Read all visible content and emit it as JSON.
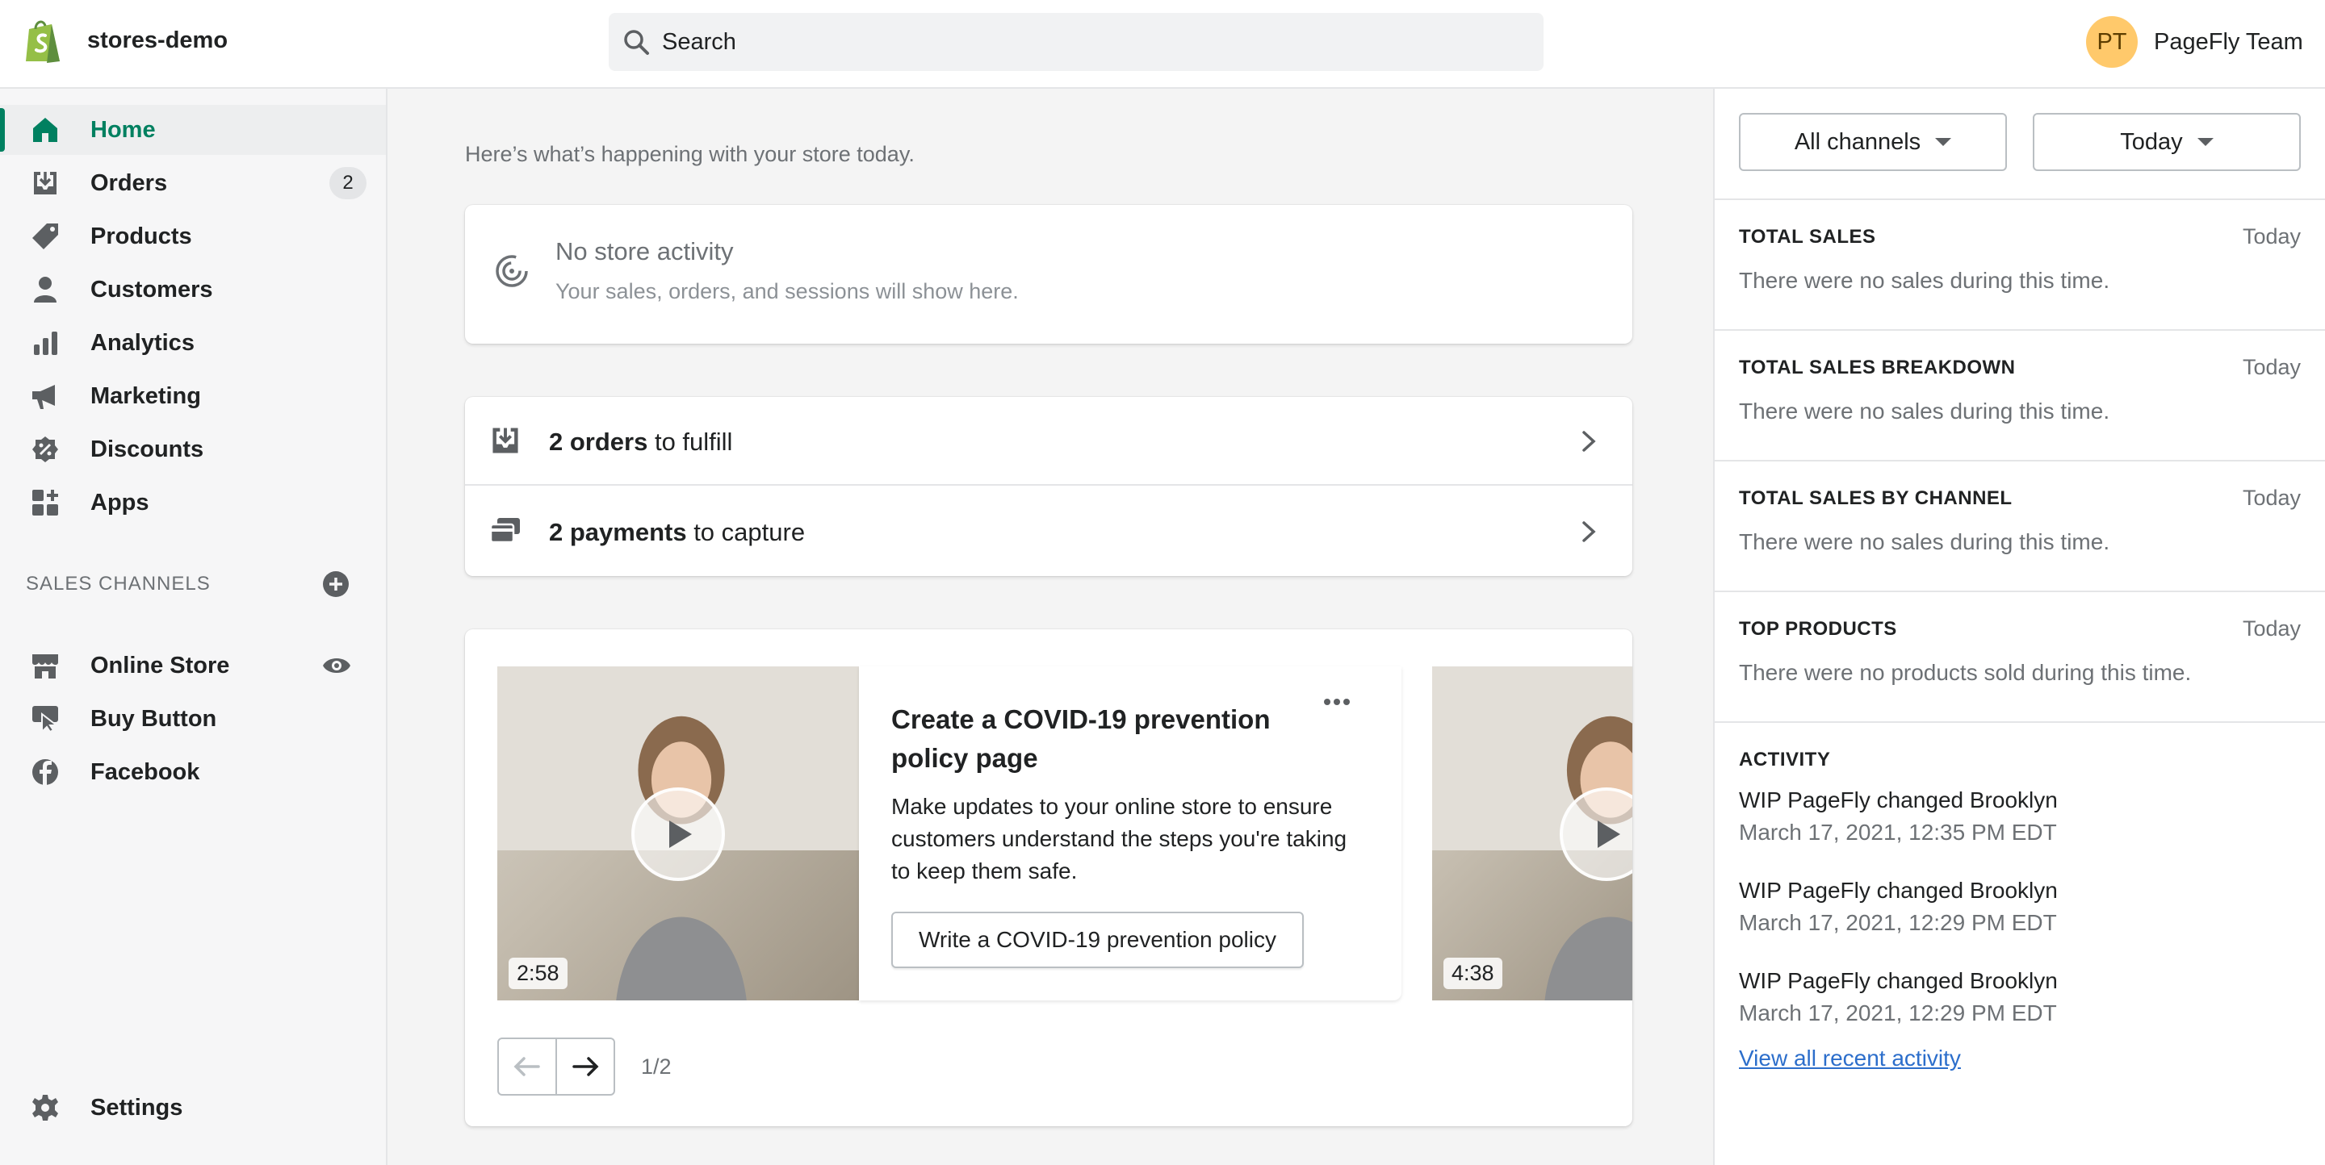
{
  "topbar": {
    "store_name": "stores-demo",
    "search_placeholder": "Search",
    "user_initials": "PT",
    "user_name": "PageFly Team"
  },
  "sidebar": {
    "items": [
      {
        "label": "Home",
        "icon": "home-icon",
        "active": true
      },
      {
        "label": "Orders",
        "icon": "orders-icon",
        "badge": "2"
      },
      {
        "label": "Products",
        "icon": "tag-icon"
      },
      {
        "label": "Customers",
        "icon": "person-icon"
      },
      {
        "label": "Analytics",
        "icon": "bar-chart-icon"
      },
      {
        "label": "Marketing",
        "icon": "megaphone-icon"
      },
      {
        "label": "Discounts",
        "icon": "discount-icon"
      },
      {
        "label": "Apps",
        "icon": "apps-icon"
      }
    ],
    "sales_channels_heading": "SALES CHANNELS",
    "channels": [
      {
        "label": "Online Store",
        "icon": "store-icon"
      },
      {
        "label": "Buy Button",
        "icon": "buy-button-icon"
      },
      {
        "label": "Facebook",
        "icon": "facebook-icon"
      }
    ],
    "settings_label": "Settings"
  },
  "main": {
    "greeting": "Here’s what’s happening with your store today.",
    "activity": {
      "title": "No store activity",
      "subtitle": "Your sales, orders, and sessions will show here."
    },
    "tasks": [
      {
        "strong": "2 orders",
        "rest": " to fulfill"
      },
      {
        "strong": "2 payments",
        "rest": " to capture"
      }
    ],
    "video": {
      "duration_a": "2:58",
      "duration_b": "4:38",
      "title": "Create a COVID-19 prevention policy page",
      "description": "Make updates to your online store to ensure customers understand the steps you're taking to keep them safe.",
      "cta": "Write a COVID-19 prevention policy",
      "page_indicator": "1/2"
    }
  },
  "right": {
    "channel_filter": "All channels",
    "date_filter": "Today",
    "metrics": [
      {
        "label": "TOTAL SALES",
        "period": "Today",
        "empty": "There were no sales during this time."
      },
      {
        "label": "TOTAL SALES BREAKDOWN",
        "period": "Today",
        "empty": "There were no sales during this time."
      },
      {
        "label": "TOTAL SALES BY CHANNEL",
        "period": "Today",
        "empty": "There were no sales during this time."
      },
      {
        "label": "TOP PRODUCTS",
        "period": "Today",
        "empty": "There were no products sold during this time."
      }
    ],
    "activity_heading": "ACTIVITY",
    "activity": [
      {
        "text": "WIP PageFly changed Brooklyn",
        "time": "March 17, 2021, 12:35 PM EDT"
      },
      {
        "text": "WIP PageFly changed Brooklyn",
        "time": "March 17, 2021, 12:29 PM EDT"
      },
      {
        "text": "WIP PageFly changed Brooklyn",
        "time": "March 17, 2021, 12:29 PM EDT"
      }
    ],
    "view_all": "View all recent activity"
  },
  "colors": {
    "accent": "#008060",
    "link": "#2c6ecb",
    "avatar": "#ffc96b",
    "logo": "#95bf47"
  }
}
